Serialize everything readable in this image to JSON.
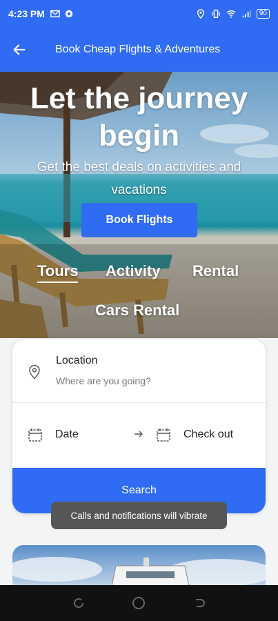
{
  "status_bar": {
    "time": "4:23 PM",
    "battery": "90"
  },
  "app_bar": {
    "title": "Book Cheap Flights & Adventures"
  },
  "hero": {
    "headline": "Let the journey begin",
    "subtitle": "Get the best deals on activities and vacations",
    "cta_label": "Book Flights",
    "tabs": [
      {
        "label": "Tours",
        "active": true
      },
      {
        "label": "Activity",
        "active": false
      },
      {
        "label": "Rental",
        "active": false
      },
      {
        "label": "Cars Rental",
        "active": false
      }
    ]
  },
  "search_card": {
    "location_label": "Location",
    "location_placeholder": "Where are you going?",
    "date_label": "Date",
    "checkout_label": "Check out",
    "search_label": "Search"
  },
  "toast": {
    "message": "Calls and notifications will vibrate"
  },
  "colors": {
    "primary": "#2f6cf3",
    "toast_bg": "#565656",
    "nav_bg": "#111111"
  }
}
